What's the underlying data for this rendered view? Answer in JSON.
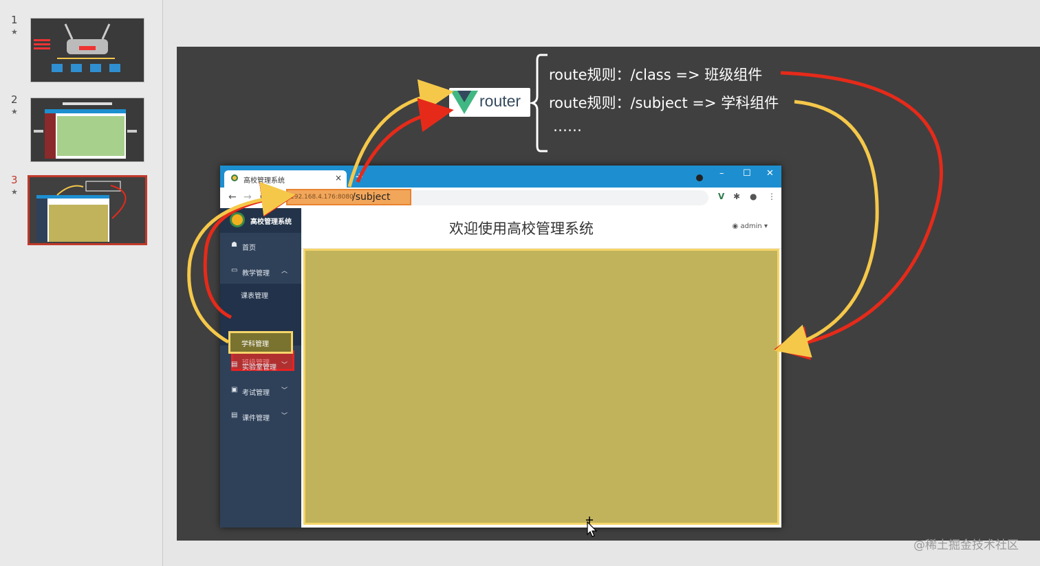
{
  "thumbnails": [
    {
      "num": "1",
      "star": "★"
    },
    {
      "num": "2",
      "star": "★"
    },
    {
      "num": "3",
      "star": "★"
    }
  ],
  "slide": {
    "router_logo": {
      "letter": "V",
      "word": "router"
    },
    "rules": [
      "route规则：/class =>  班级组件",
      "route规则：/subject => 学科组件",
      "……"
    ]
  },
  "browser": {
    "tab_title": "高校管理系统",
    "tab_close": "×",
    "new_tab": "+",
    "window_controls": [
      "–",
      "☐",
      "✕"
    ],
    "url_host": "192.168.4.176:8080",
    "url_path": "/subject",
    "back": "←",
    "forward": "→",
    "reload": "⟳",
    "tool_icons": [
      "V",
      "✱",
      "●",
      "⋮"
    ]
  },
  "app": {
    "brand": "高校管理系统",
    "header_title": "欢迎使用高校管理系统",
    "user": "admin",
    "user_icon": "user-circle-icon",
    "menu": [
      {
        "icon": "☗",
        "label": "首页",
        "arrow": ""
      },
      {
        "icon": "▭",
        "label": "教学管理",
        "arrow": "︿"
      },
      {
        "icon": "▤",
        "label": "实验室管理",
        "arrow": "﹀"
      },
      {
        "icon": "▣",
        "label": "考试管理",
        "arrow": "﹀"
      },
      {
        "icon": "▤",
        "label": "课件管理",
        "arrow": "﹀"
      }
    ],
    "submenu": [
      "课表管理",
      "班级管理",
      "学科管理"
    ]
  },
  "watermark": "@稀土掘金技术社区",
  "colors": {
    "slide_bg": "#404040",
    "sidebar_bg": "#2f4159",
    "content_bg": "#c1b35b",
    "red_arrow": "#e62a1a",
    "yellow_arrow": "#f5c84a",
    "tabbar": "#1d8fd0"
  }
}
